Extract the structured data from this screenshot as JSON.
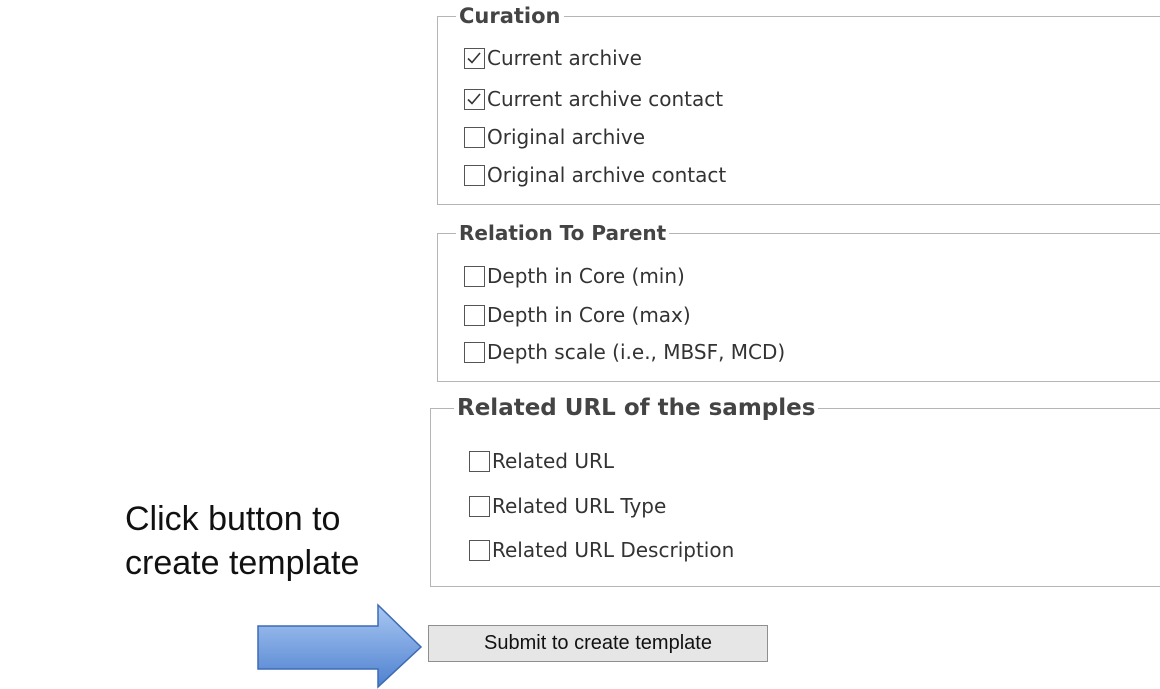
{
  "curation": {
    "legend": "Curation",
    "items": [
      {
        "label": "Current archive",
        "checked": true
      },
      {
        "label": "Current archive contact",
        "checked": true
      },
      {
        "label": "Original archive",
        "checked": false
      },
      {
        "label": "Original archive contact",
        "checked": false
      }
    ]
  },
  "relation": {
    "legend": "Relation To Parent",
    "items": [
      {
        "label": "Depth in Core (min)",
        "checked": false
      },
      {
        "label": "Depth in Core (max)",
        "checked": false
      },
      {
        "label": "Depth scale (i.e., MBSF, MCD)",
        "checked": false
      }
    ]
  },
  "related_url": {
    "legend": "Related URL of the samples",
    "items": [
      {
        "label": "Related URL",
        "checked": false
      },
      {
        "label": "Related URL Type",
        "checked": false
      },
      {
        "label": "Related URL Description",
        "checked": false
      }
    ]
  },
  "hint": {
    "line1": "Click button to",
    "line2": "create template"
  },
  "submit": {
    "label": "Submit to create template"
  },
  "colors": {
    "arrow_fill_top": "#a9c8f2",
    "arrow_fill_bottom": "#4f81d0",
    "arrow_stroke": "#3d6bb5"
  },
  "icons": {
    "checkbox_checked": "checkmark-icon",
    "pointer": "right-arrow-icon"
  }
}
